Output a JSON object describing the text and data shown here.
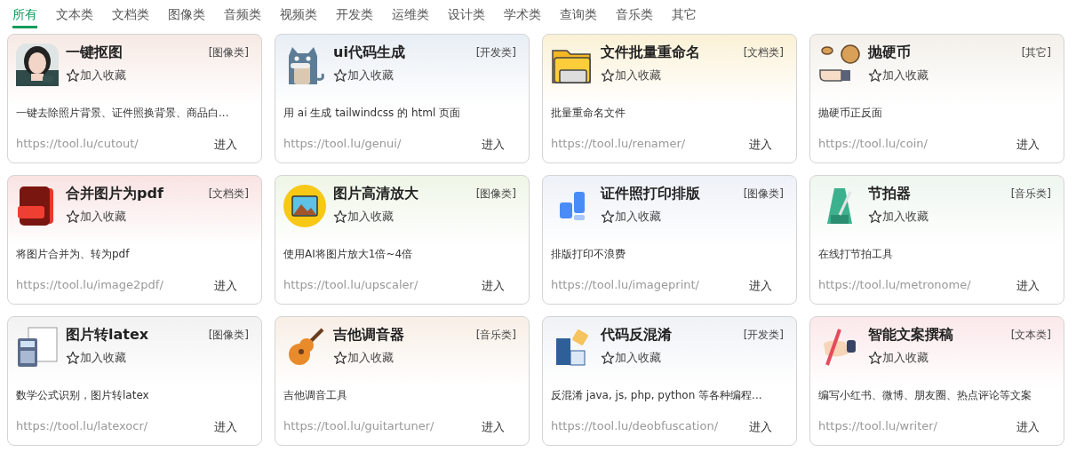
{
  "tabs": [
    {
      "label": "所有",
      "selected": true
    },
    {
      "label": "文本类",
      "selected": false
    },
    {
      "label": "文档类",
      "selected": false
    },
    {
      "label": "图像类",
      "selected": false
    },
    {
      "label": "音频类",
      "selected": false
    },
    {
      "label": "视频类",
      "selected": false
    },
    {
      "label": "开发类",
      "selected": false
    },
    {
      "label": "运维类",
      "selected": false
    },
    {
      "label": "设计类",
      "selected": false
    },
    {
      "label": "学术类",
      "selected": false
    },
    {
      "label": "查询类",
      "selected": false
    },
    {
      "label": "音乐类",
      "selected": false
    },
    {
      "label": "其它",
      "selected": false
    }
  ],
  "cards": [
    {
      "title": "一键抠图",
      "category": "[图像类]",
      "favorite": "加入收藏",
      "description": "一键去除照片背景、证件照换背景、商品白...",
      "url": "https://tool.lu/cutout/",
      "action": "进入"
    },
    {
      "title": "ui代码生成",
      "category": "[开发类]",
      "favorite": "加入收藏",
      "description": "用 ai 生成 tailwindcss 的 html 页面",
      "url": "https://tool.lu/genui/",
      "action": "进入"
    },
    {
      "title": "文件批量重命名",
      "category": "[文档类]",
      "favorite": "加入收藏",
      "description": "批量重命名文件",
      "url": "https://tool.lu/renamer/",
      "action": "进入"
    },
    {
      "title": "抛硬币",
      "category": "[其它]",
      "favorite": "加入收藏",
      "description": "抛硬币正反面",
      "url": "https://tool.lu/coin/",
      "action": "进入"
    },
    {
      "title": "合并图片为pdf",
      "category": "[文档类]",
      "favorite": "加入收藏",
      "description": "将图片合并为、转为pdf",
      "url": "https://tool.lu/image2pdf/",
      "action": "进入"
    },
    {
      "title": "图片高清放大",
      "category": "[图像类]",
      "favorite": "加入收藏",
      "description": "使用AI将图片放大1倍~4倍",
      "url": "https://tool.lu/upscaler/",
      "action": "进入"
    },
    {
      "title": "证件照打印排版",
      "category": "[图像类]",
      "favorite": "加入收藏",
      "description": "排版打印不浪费",
      "url": "https://tool.lu/imageprint/",
      "action": "进入"
    },
    {
      "title": "节拍器",
      "category": "[音乐类]",
      "favorite": "加入收藏",
      "description": "在线打节拍工具",
      "url": "https://tool.lu/metronome/",
      "action": "进入"
    },
    {
      "title": "图片转latex",
      "category": "[图像类]",
      "favorite": "加入收藏",
      "description": "数学公式识别，图片转latex",
      "url": "https://tool.lu/latexocr/",
      "action": "进入"
    },
    {
      "title": "吉他调音器",
      "category": "[音乐类]",
      "favorite": "加入收藏",
      "description": "吉他调音工具",
      "url": "https://tool.lu/guitartuner/",
      "action": "进入"
    },
    {
      "title": "代码反混淆",
      "category": "[开发类]",
      "favorite": "加入收藏",
      "description": "反混淆 java, js, php, python 等各种编程...",
      "url": "https://tool.lu/deobfuscation/",
      "action": "进入"
    },
    {
      "title": "智能文案撰稿",
      "category": "[文本类]",
      "favorite": "加入收藏",
      "description": "编写小红书、微博、朋友圈、热点评论等文案",
      "url": "https://tool.lu/writer/",
      "action": "进入"
    }
  ]
}
